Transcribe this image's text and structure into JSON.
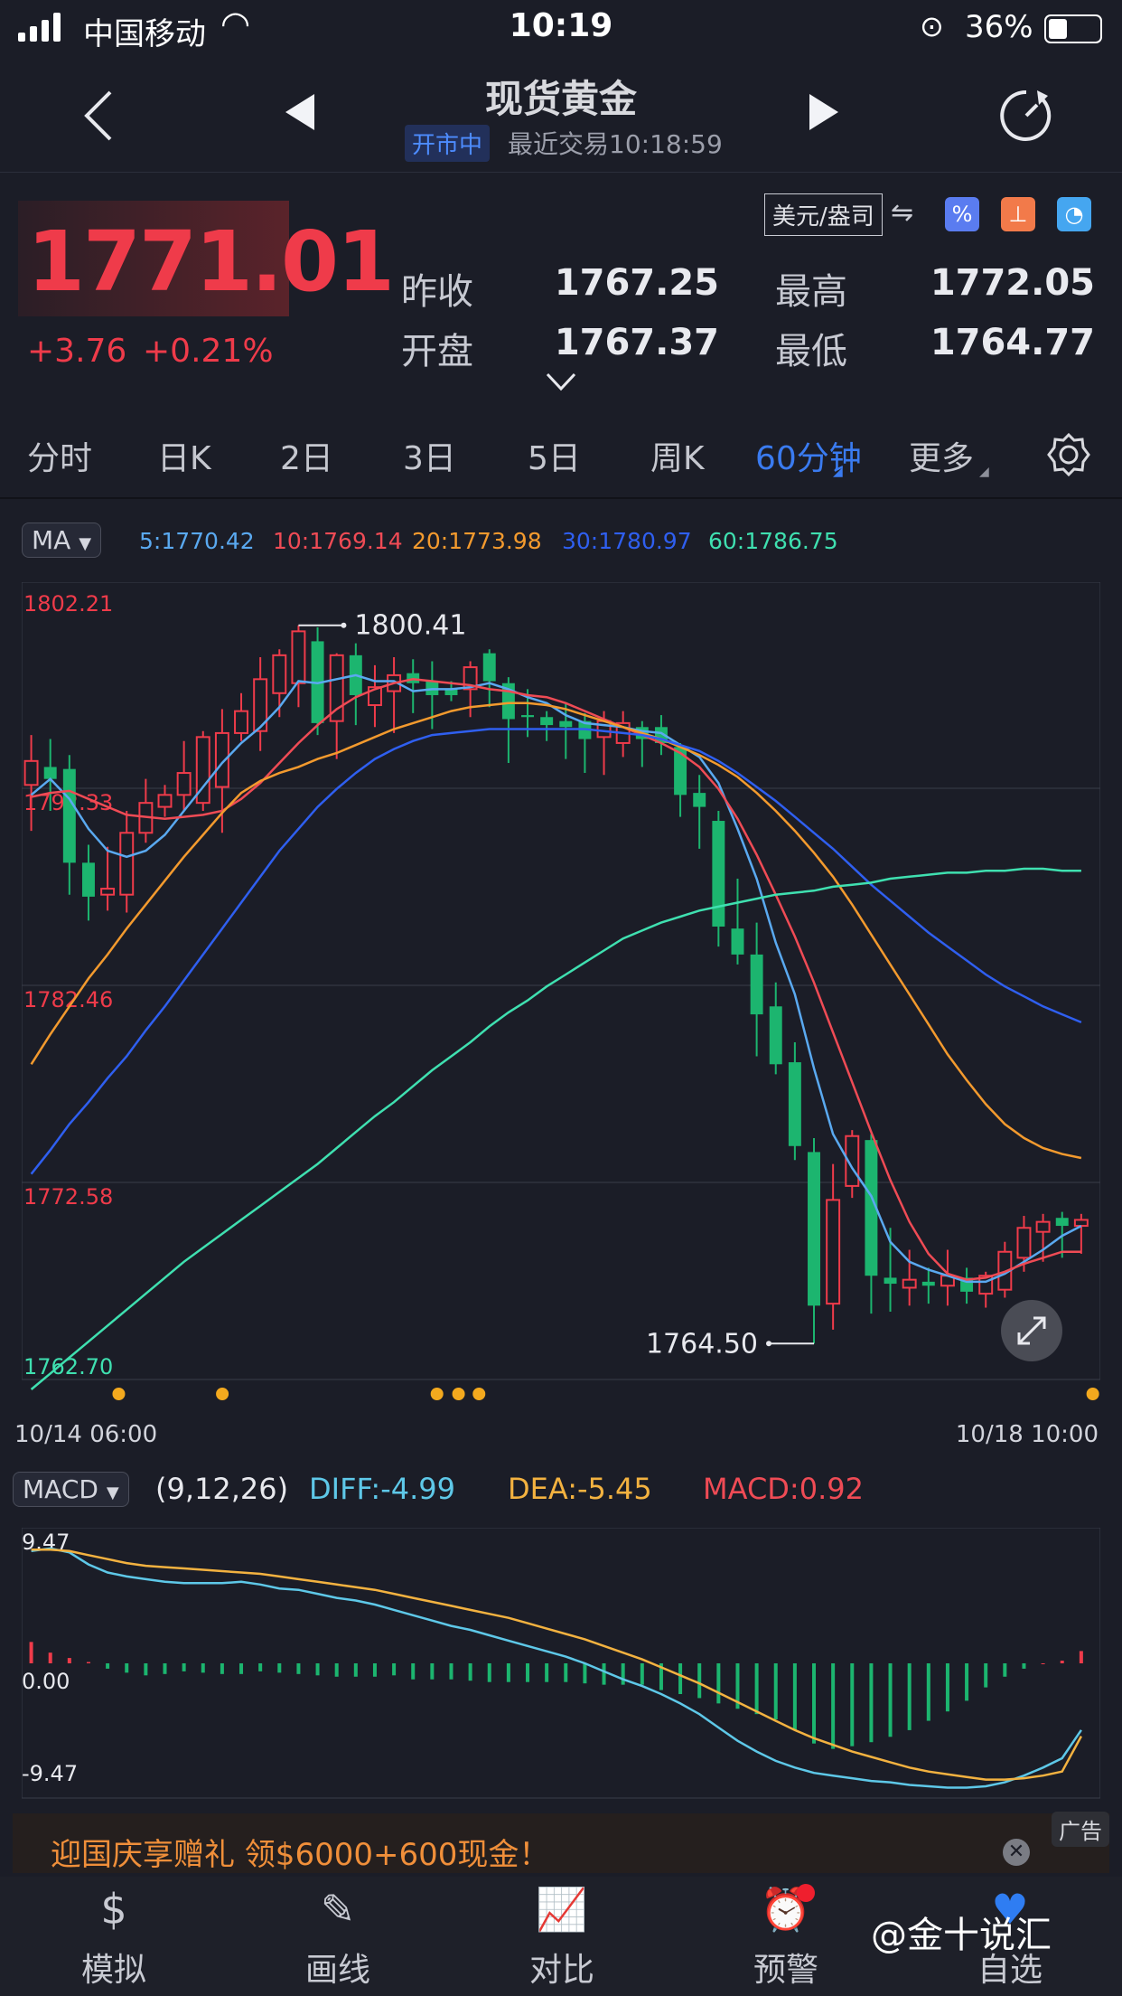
{
  "status_bar": {
    "carrier": "中国移动",
    "time": "10:19",
    "battery": "36%"
  },
  "header": {
    "title": "现货黄金",
    "market_status": "开市中",
    "last_trade": "最近交易10:18:59"
  },
  "quote": {
    "price": "1771.01",
    "change": "+3.76",
    "change_pct": "+0.21%",
    "unit": "美元/盎司",
    "prev_close_label": "昨收",
    "prev_close": "1767.25",
    "open_label": "开盘",
    "open": "1767.37",
    "high_label": "最高",
    "high": "1772.05",
    "low_label": "最低",
    "low": "1764.77"
  },
  "tabs": [
    {
      "label": "分时"
    },
    {
      "label": "日K"
    },
    {
      "label": "2日"
    },
    {
      "label": "3日"
    },
    {
      "label": "5日"
    },
    {
      "label": "周K"
    },
    {
      "label": "60分钟"
    },
    {
      "label": "更多"
    }
  ],
  "active_tab": "60分钟",
  "ma_legend": {
    "selector": "MA",
    "items": [
      {
        "text": "5:1770.42",
        "color": "#5aa9f0"
      },
      {
        "text": "10:1769.14",
        "color": "#ef4b55"
      },
      {
        "text": "20:1773.98",
        "color": "#f39a2e"
      },
      {
        "text": "30:1780.97",
        "color": "#2f5ff0"
      },
      {
        "text": "60:1786.75",
        "color": "#3fe0b0"
      }
    ]
  },
  "main_axis": {
    "labels": [
      "1802.21",
      "1792.33",
      "1782.46",
      "1772.58",
      "1762.70"
    ],
    "x_start": "10/14 06:00",
    "x_end": "10/18 10:00"
  },
  "annotations": {
    "max": "1800.41",
    "min": "1764.50"
  },
  "macd_legend": {
    "selector": "MACD",
    "params": "(9,12,26)",
    "diff": "DIFF:-4.99",
    "dea": "DEA:-5.45",
    "macd": "MACD:0.92"
  },
  "macd_axis": {
    "labels": [
      "9.47",
      "0.00",
      "-9.47"
    ]
  },
  "ad": {
    "text": "迎国庆享赠礼 领$6000+600现金！",
    "tag": "广告"
  },
  "bottom_nav": [
    {
      "label": "模拟"
    },
    {
      "label": "画线"
    },
    {
      "label": "对比"
    },
    {
      "label": "预警"
    },
    {
      "label": "自选"
    }
  ],
  "watermark": "@金十说汇",
  "colors": {
    "up": "#ef3b4a",
    "down": "#1cb56f",
    "accent": "#3a7bf0"
  },
  "chart_data": [
    {
      "type": "candlestick",
      "ylim": [
        1762.7,
        1802.21
      ],
      "candles": [
        {
          "o": 1792.5,
          "h": 1795.0,
          "c": 1793.7,
          "l": 1790.2
        },
        {
          "o": 1793.4,
          "h": 1794.8,
          "c": 1792.8,
          "l": 1791.2
        },
        {
          "o": 1793.3,
          "h": 1794.0,
          "c": 1788.6,
          "l": 1787.0
        },
        {
          "o": 1788.6,
          "h": 1789.5,
          "c": 1786.9,
          "l": 1785.7
        },
        {
          "o": 1787.0,
          "h": 1789.4,
          "c": 1787.3,
          "l": 1786.2
        },
        {
          "o": 1787.0,
          "h": 1791.2,
          "c": 1790.1,
          "l": 1786.1
        },
        {
          "o": 1790.1,
          "h": 1792.8,
          "c": 1791.6,
          "l": 1789.6
        },
        {
          "o": 1791.4,
          "h": 1792.5,
          "c": 1792.0,
          "l": 1790.9
        },
        {
          "o": 1792.0,
          "h": 1794.7,
          "c": 1793.1,
          "l": 1791.2
        },
        {
          "o": 1791.6,
          "h": 1795.2,
          "c": 1794.9,
          "l": 1791.2
        },
        {
          "o": 1792.4,
          "h": 1796.3,
          "c": 1795.1,
          "l": 1790.1
        },
        {
          "o": 1795.1,
          "h": 1797.1,
          "c": 1796.2,
          "l": 1794.7
        },
        {
          "o": 1795.2,
          "h": 1798.9,
          "c": 1797.8,
          "l": 1794.2
        },
        {
          "o": 1797.1,
          "h": 1799.3,
          "c": 1799.0,
          "l": 1795.9
        },
        {
          "o": 1797.6,
          "h": 1800.5,
          "c": 1800.2,
          "l": 1796.4
        },
        {
          "o": 1799.7,
          "h": 1800.4,
          "c": 1795.6,
          "l": 1795.0
        },
        {
          "o": 1795.7,
          "h": 1799.1,
          "c": 1799.0,
          "l": 1793.8
        },
        {
          "o": 1799.0,
          "h": 1799.6,
          "c": 1797.0,
          "l": 1795.5
        },
        {
          "o": 1796.5,
          "h": 1798.5,
          "c": 1797.4,
          "l": 1795.4
        },
        {
          "o": 1797.2,
          "h": 1798.9,
          "c": 1798.0,
          "l": 1795.1
        },
        {
          "o": 1798.1,
          "h": 1798.8,
          "c": 1797.6,
          "l": 1796.1
        },
        {
          "o": 1797.7,
          "h": 1798.7,
          "c": 1797.0,
          "l": 1795.3
        },
        {
          "o": 1797.3,
          "h": 1797.7,
          "c": 1797.0,
          "l": 1796.7
        },
        {
          "o": 1797.3,
          "h": 1798.7,
          "c": 1798.4,
          "l": 1795.9
        },
        {
          "o": 1799.1,
          "h": 1799.3,
          "c": 1797.7,
          "l": 1796.4
        },
        {
          "o": 1797.6,
          "h": 1797.9,
          "c": 1795.8,
          "l": 1793.6
        },
        {
          "o": 1796.0,
          "h": 1797.3,
          "c": 1795.9,
          "l": 1794.9
        },
        {
          "o": 1795.9,
          "h": 1796.2,
          "c": 1795.5,
          "l": 1794.7
        },
        {
          "o": 1795.7,
          "h": 1796.6,
          "c": 1795.4,
          "l": 1793.8
        },
        {
          "o": 1795.7,
          "h": 1796.1,
          "c": 1794.8,
          "l": 1793.1
        },
        {
          "o": 1794.9,
          "h": 1796.2,
          "c": 1795.7,
          "l": 1793.0
        },
        {
          "o": 1794.6,
          "h": 1796.2,
          "c": 1795.6,
          "l": 1793.9
        },
        {
          "o": 1795.4,
          "h": 1795.7,
          "c": 1794.8,
          "l": 1793.4
        },
        {
          "o": 1795.4,
          "h": 1796.0,
          "c": 1794.6,
          "l": 1794.0
        },
        {
          "o": 1794.4,
          "h": 1794.6,
          "c": 1792.0,
          "l": 1790.9
        },
        {
          "o": 1792.1,
          "h": 1793.0,
          "c": 1791.4,
          "l": 1789.3
        },
        {
          "o": 1790.7,
          "h": 1791.2,
          "c": 1785.4,
          "l": 1784.4
        },
        {
          "o": 1785.3,
          "h": 1787.8,
          "c": 1784.0,
          "l": 1783.5
        },
        {
          "o": 1784.0,
          "h": 1785.6,
          "c": 1781.0,
          "l": 1778.9
        },
        {
          "o": 1781.4,
          "h": 1782.6,
          "c": 1778.5,
          "l": 1778.0
        },
        {
          "o": 1778.6,
          "h": 1779.6,
          "c": 1774.4,
          "l": 1773.7
        },
        {
          "o": 1774.1,
          "h": 1774.8,
          "c": 1766.4,
          "l": 1764.5
        },
        {
          "o": 1766.5,
          "h": 1773.5,
          "c": 1771.7,
          "l": 1765.2
        },
        {
          "o": 1772.4,
          "h": 1775.2,
          "c": 1774.9,
          "l": 1771.8
        },
        {
          "o": 1774.7,
          "h": 1775.0,
          "c": 1767.9,
          "l": 1766.0
        },
        {
          "o": 1767.8,
          "h": 1770.3,
          "c": 1767.5,
          "l": 1766.1
        },
        {
          "o": 1767.3,
          "h": 1769.2,
          "c": 1767.7,
          "l": 1766.4
        },
        {
          "o": 1767.6,
          "h": 1768.3,
          "c": 1767.4,
          "l": 1766.5
        },
        {
          "o": 1767.4,
          "h": 1769.2,
          "c": 1767.9,
          "l": 1766.4
        },
        {
          "o": 1767.8,
          "h": 1768.3,
          "c": 1767.1,
          "l": 1766.5
        },
        {
          "o": 1767.0,
          "h": 1768.1,
          "c": 1767.9,
          "l": 1766.3
        },
        {
          "o": 1767.2,
          "h": 1769.6,
          "c": 1769.1,
          "l": 1766.8
        },
        {
          "o": 1768.8,
          "h": 1770.9,
          "c": 1770.3,
          "l": 1768.1
        },
        {
          "o": 1770.1,
          "h": 1771.0,
          "c": 1770.6,
          "l": 1768.6
        },
        {
          "o": 1770.8,
          "h": 1771.1,
          "c": 1770.4,
          "l": 1768.8
        },
        {
          "o": 1770.4,
          "h": 1771.0,
          "c": 1770.7,
          "l": 1769.0
        }
      ],
      "ma": {
        "5": [
          1792.0,
          1792.8,
          1791.8,
          1790.3,
          1789.2,
          1788.9,
          1789.2,
          1790.0,
          1791.2,
          1792.4,
          1793.6,
          1794.6,
          1795.4,
          1796.4,
          1797.7,
          1797.6,
          1797.8,
          1798.0,
          1797.7,
          1797.7,
          1797.2,
          1797.3,
          1797.3,
          1797.4,
          1797.6,
          1797.3,
          1796.9,
          1796.6,
          1796.0,
          1795.6,
          1795.5,
          1795.4,
          1795.2,
          1795.1,
          1794.5,
          1793.9,
          1792.6,
          1790.3,
          1787.8,
          1784.6,
          1782.0,
          1778.3,
          1775.0,
          1773.3,
          1771.9,
          1769.6,
          1768.6,
          1768.2,
          1767.9,
          1767.6,
          1767.6,
          1768.0,
          1768.6,
          1769.2,
          1769.9,
          1770.4
        ],
        "10": [
          1791.9,
          1792.1,
          1792.2,
          1791.8,
          1791.4,
          1791.0,
          1790.9,
          1790.8,
          1790.9,
          1791.0,
          1791.2,
          1791.8,
          1792.6,
          1793.6,
          1794.6,
          1795.5,
          1796.3,
          1796.9,
          1797.3,
          1797.6,
          1797.8,
          1797.7,
          1797.6,
          1797.5,
          1797.3,
          1797.2,
          1797.0,
          1796.9,
          1796.6,
          1796.2,
          1795.8,
          1795.4,
          1795.0,
          1794.6,
          1794.1,
          1793.4,
          1792.3,
          1790.8,
          1789.0,
          1787.0,
          1784.9,
          1782.6,
          1780.1,
          1777.6,
          1775.1,
          1772.7,
          1770.6,
          1769.0,
          1768.0,
          1767.7,
          1767.8,
          1768.1,
          1768.5,
          1768.8,
          1769.1,
          1769.1
        ],
        "20": [
          1778.5,
          1780.0,
          1781.4,
          1782.8,
          1784.0,
          1785.3,
          1786.5,
          1787.7,
          1788.9,
          1790.0,
          1791.1,
          1792.1,
          1792.7,
          1793.1,
          1793.4,
          1793.8,
          1794.1,
          1794.5,
          1794.9,
          1795.3,
          1795.6,
          1795.9,
          1796.2,
          1796.4,
          1796.5,
          1796.6,
          1796.6,
          1796.5,
          1796.3,
          1796.0,
          1795.7,
          1795.4,
          1795.1,
          1794.8,
          1794.4,
          1794.0,
          1793.5,
          1792.9,
          1792.1,
          1791.2,
          1790.2,
          1789.1,
          1787.9,
          1786.5,
          1785.0,
          1783.5,
          1782.0,
          1780.5,
          1779.0,
          1777.7,
          1776.5,
          1775.5,
          1774.8,
          1774.3,
          1774.0,
          1773.8
        ],
        "30": [
          1773.0,
          1774.2,
          1775.5,
          1776.6,
          1777.8,
          1778.9,
          1780.2,
          1781.4,
          1782.7,
          1784.0,
          1785.3,
          1786.6,
          1787.9,
          1789.2,
          1790.3,
          1791.4,
          1792.3,
          1793.1,
          1793.8,
          1794.3,
          1794.7,
          1795.0,
          1795.1,
          1795.2,
          1795.3,
          1795.3,
          1795.3,
          1795.3,
          1795.3,
          1795.3,
          1795.2,
          1795.1,
          1795.0,
          1794.8,
          1794.5,
          1794.2,
          1793.7,
          1793.1,
          1792.4,
          1791.7,
          1790.9,
          1790.1,
          1789.3,
          1788.4,
          1787.5,
          1786.7,
          1785.9,
          1785.1,
          1784.4,
          1783.7,
          1783.0,
          1782.4,
          1781.9,
          1781.4,
          1781.0,
          1780.6
        ],
        "60": [
          1762.2,
          1763.0,
          1763.8,
          1764.6,
          1765.4,
          1766.2,
          1767.0,
          1767.8,
          1768.6,
          1769.3,
          1770.0,
          1770.7,
          1771.4,
          1772.1,
          1772.8,
          1773.5,
          1774.3,
          1775.1,
          1775.9,
          1776.6,
          1777.4,
          1778.2,
          1778.9,
          1779.6,
          1780.4,
          1781.1,
          1781.7,
          1782.4,
          1783.0,
          1783.6,
          1784.2,
          1784.8,
          1785.2,
          1785.6,
          1785.9,
          1786.2,
          1786.4,
          1786.6,
          1786.8,
          1787.0,
          1787.1,
          1787.2,
          1787.4,
          1787.5,
          1787.6,
          1787.8,
          1787.9,
          1788.0,
          1788.1,
          1788.1,
          1788.2,
          1788.2,
          1788.3,
          1788.3,
          1788.2,
          1788.2
        ]
      }
    },
    {
      "type": "bar",
      "ylim": [
        -9.47,
        9.47
      ],
      "macd": [
        1.6,
        0.8,
        0.4,
        0.1,
        -0.4,
        -0.7,
        -0.9,
        -0.8,
        -0.6,
        -0.7,
        -0.8,
        -0.8,
        -0.6,
        -0.7,
        -0.8,
        -0.9,
        -1.0,
        -1.0,
        -1.0,
        -0.9,
        -1.2,
        -1.2,
        -1.2,
        -1.3,
        -1.4,
        -1.4,
        -1.4,
        -1.4,
        -1.4,
        -1.5,
        -1.6,
        -1.6,
        -1.6,
        -2.0,
        -2.3,
        -2.6,
        -3.0,
        -3.4,
        -3.8,
        -4.2,
        -5.0,
        -6.0,
        -6.4,
        -6.2,
        -5.9,
        -5.5,
        -5.0,
        -4.3,
        -3.6,
        -2.8,
        -1.8,
        -1.0,
        -0.4,
        0.0,
        0.2,
        0.92
      ],
      "diff": [
        8.4,
        8.6,
        8.3,
        7.4,
        6.8,
        6.5,
        6.3,
        6.1,
        6.0,
        6.0,
        6.0,
        6.1,
        5.9,
        5.6,
        5.5,
        5.2,
        4.9,
        4.7,
        4.4,
        4.0,
        3.6,
        3.2,
        2.8,
        2.5,
        2.1,
        1.7,
        1.3,
        0.9,
        0.5,
        0.0,
        -0.6,
        -1.2,
        -1.7,
        -2.3,
        -3.0,
        -3.8,
        -4.8,
        -5.8,
        -6.6,
        -7.3,
        -7.8,
        -8.2,
        -8.4,
        -8.6,
        -8.8,
        -8.9,
        -9.1,
        -9.2,
        -9.3,
        -9.3,
        -9.2,
        -8.9,
        -8.4,
        -7.8,
        -7.1,
        -4.99
      ],
      "dea": [
        8.5,
        8.5,
        8.4,
        8.1,
        7.8,
        7.5,
        7.3,
        7.2,
        7.1,
        7.0,
        6.9,
        6.8,
        6.7,
        6.5,
        6.3,
        6.1,
        5.9,
        5.7,
        5.5,
        5.2,
        4.9,
        4.6,
        4.3,
        4.0,
        3.7,
        3.4,
        3.0,
        2.6,
        2.2,
        1.8,
        1.3,
        0.8,
        0.3,
        -0.3,
        -0.9,
        -1.5,
        -2.2,
        -2.9,
        -3.6,
        -4.3,
        -5.0,
        -5.6,
        -6.1,
        -6.6,
        -7.0,
        -7.4,
        -7.8,
        -8.1,
        -8.3,
        -8.5,
        -8.7,
        -8.7,
        -8.6,
        -8.4,
        -8.1,
        -5.45
      ]
    }
  ]
}
